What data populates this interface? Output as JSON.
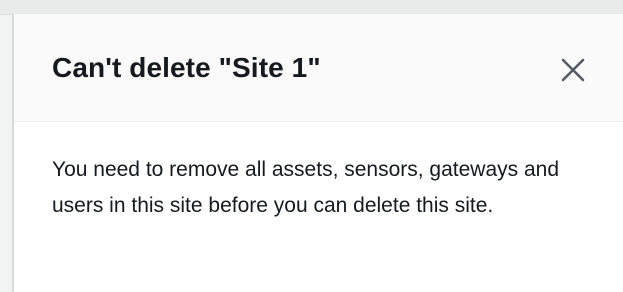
{
  "dialog": {
    "title": "Can't delete \"Site 1\"",
    "close_icon": "close-icon",
    "message": "You need to remove all assets, sensors, gateways and users in this site before you can delete this site."
  },
  "colors": {
    "text": "#16191f",
    "header_background": "#fafafa",
    "body_background": "#ffffff",
    "border": "#eaeded"
  }
}
